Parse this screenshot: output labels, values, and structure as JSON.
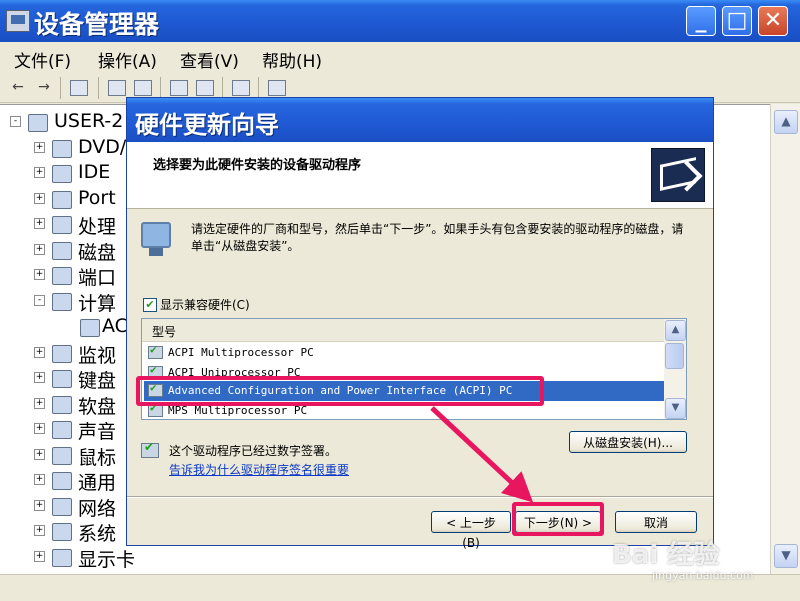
{
  "window": {
    "title": "设备管理器",
    "min_glyph": "_",
    "max_glyph": "□",
    "close_glyph": "✕"
  },
  "menu": [
    {
      "label": "文件(F)"
    },
    {
      "label": "操作(A)"
    },
    {
      "label": "查看(V)"
    },
    {
      "label": "帮助(H)"
    }
  ],
  "toolbar": {
    "back_glyph": "←",
    "forward_glyph": "→",
    "icons": [
      "properties-icon",
      "print-icon",
      "help-icon",
      "view-icon",
      "scan-icon",
      "update-driver-icon"
    ]
  },
  "tree": {
    "root": "USER-2",
    "items": [
      {
        "label": "DVD/",
        "expander": "+"
      },
      {
        "label": "IDE",
        "expander": "+"
      },
      {
        "label": "Port",
        "expander": "+"
      },
      {
        "label": "处理",
        "expander": "+"
      },
      {
        "label": "磁盘",
        "expander": "+"
      },
      {
        "label": "端口",
        "expander": "+"
      },
      {
        "label": "计算",
        "expander": "-"
      },
      {
        "label": "AC",
        "expander": ""
      },
      {
        "label": "监视",
        "expander": "+"
      },
      {
        "label": "键盘",
        "expander": "+"
      },
      {
        "label": "软盘",
        "expander": "+"
      },
      {
        "label": "声音",
        "expander": "+"
      },
      {
        "label": "鼠标",
        "expander": "+"
      },
      {
        "label": "通用",
        "expander": "+"
      },
      {
        "label": "网络",
        "expander": "+"
      },
      {
        "label": "系统",
        "expander": "+"
      },
      {
        "label": "显示卡",
        "expander": "+"
      }
    ],
    "root_expander": "-"
  },
  "scroll": {
    "up": "▲",
    "down": "▼"
  },
  "wizard": {
    "title": "硬件更新向导",
    "header_title": "选择要为此硬件安装的设备驱动程序",
    "instruction": "请选定硬件的厂商和型号，然后单击“下一步”。如果手头有包含要安装的驱动程序的磁盘，请单击“从磁盘安装”。",
    "show_compatible": {
      "label": "显示兼容硬件(C)",
      "checked": true,
      "check_glyph": "✔"
    },
    "list_header": "型号",
    "models": [
      {
        "name": "ACPI Multiprocessor PC",
        "selected": false
      },
      {
        "name": "ACPI Uniprocessor PC",
        "selected": false
      },
      {
        "name": "Advanced Configuration and Power Interface (ACPI) PC",
        "selected": true
      },
      {
        "name": "MPS Multiprocessor PC",
        "selected": false
      }
    ],
    "signed_text": "这个驱动程序已经过数字签署。",
    "sign_link": "告诉我为什么驱动程序签名很重要",
    "have_disk_button": "从磁盘安装(H)...",
    "back_button": "< 上一步(B)",
    "next_button": "下一步(N) >",
    "cancel_button": "取消"
  },
  "annotation": {
    "color": "#e8165e"
  },
  "watermark": {
    "logo": "Bai 经验",
    "url": "jingyan.baidu.com"
  }
}
